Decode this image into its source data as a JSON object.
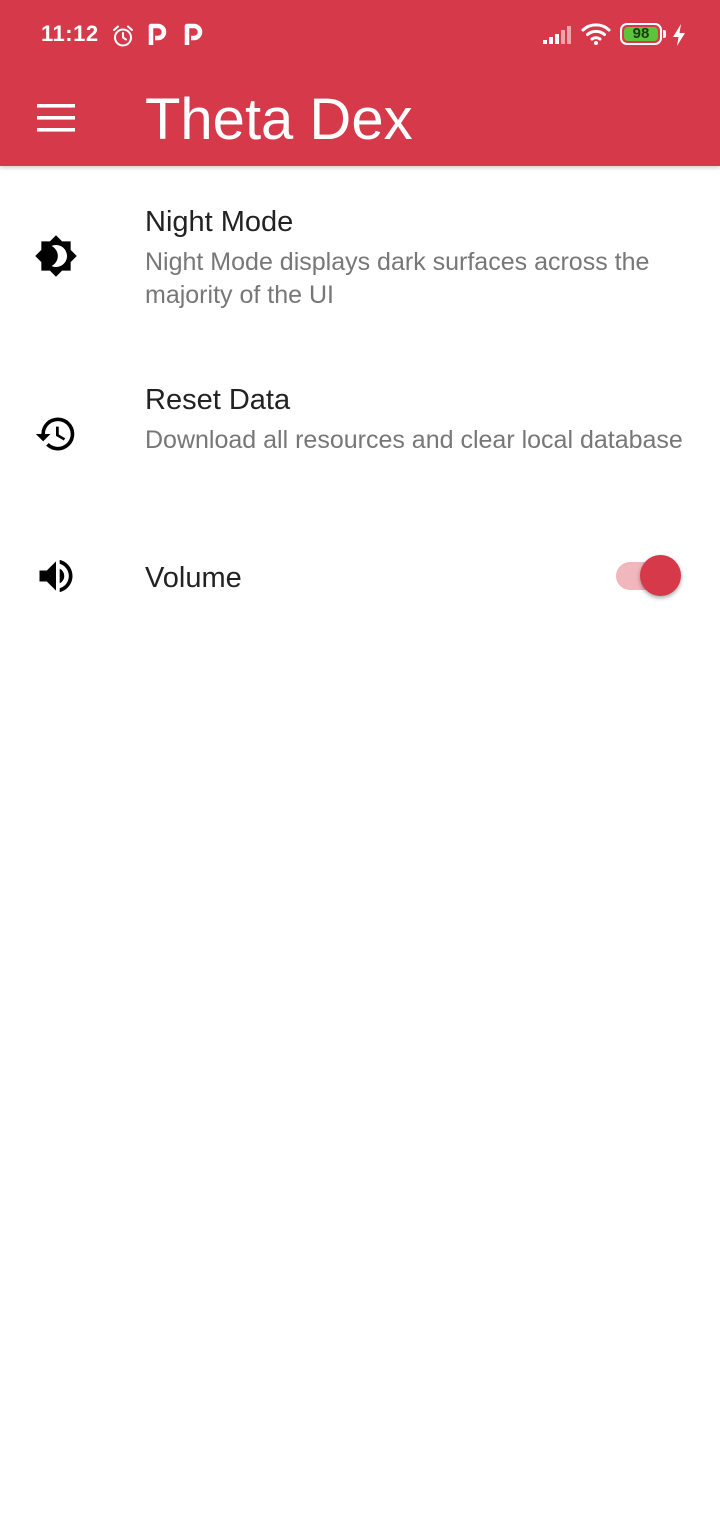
{
  "status_bar": {
    "time": "11:12",
    "battery_level": "98",
    "battery_color": "#5cc43a",
    "icons": [
      "alarm-icon",
      "parking-icon",
      "parking-icon",
      "signal-icon",
      "wifi-icon",
      "battery-icon",
      "charging-icon"
    ]
  },
  "app_bar": {
    "title": "Theta Dex",
    "background_color": "#d6394a",
    "menu_icon": "menu-icon"
  },
  "settings": {
    "night_mode": {
      "icon": "brightness-moon-icon",
      "title": "Night Mode",
      "description": "Night Mode displays dark surfaces across the majority of the UI"
    },
    "reset_data": {
      "icon": "restore-history-icon",
      "title": "Reset Data",
      "description": "Download all resources and clear local database"
    },
    "volume": {
      "icon": "volume-up-icon",
      "title": "Volume",
      "enabled": true,
      "toggle_color": "#d6394a"
    }
  }
}
